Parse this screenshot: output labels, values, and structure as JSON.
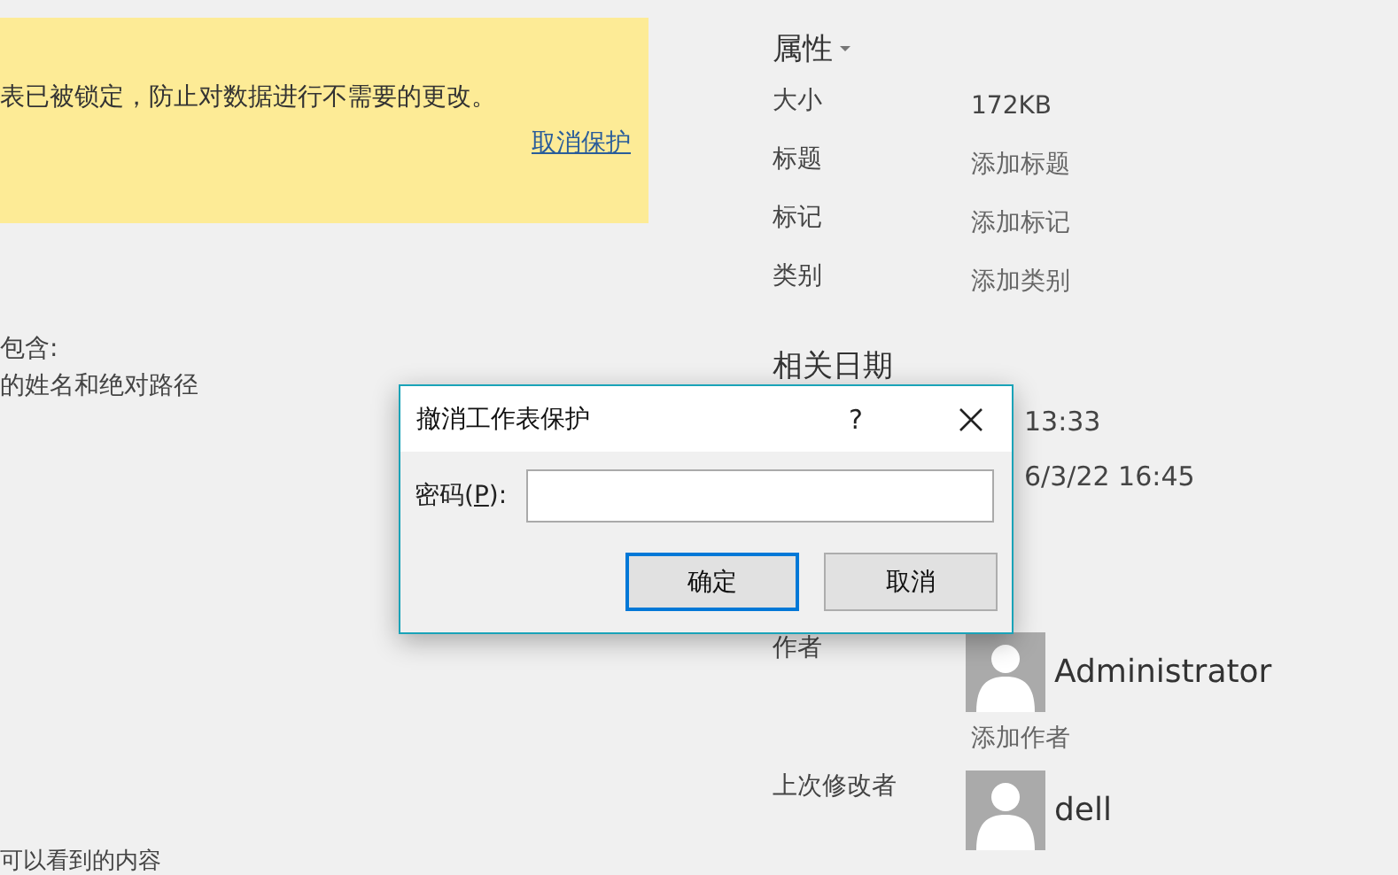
{
  "protection_notice": {
    "message": "表已被锁定，防止对数据进行不需要的更改。",
    "link": "取消保护"
  },
  "inspect_section": {
    "lines": [
      "包含:",
      "的姓名和绝对路径"
    ]
  },
  "bottom_text": "可以看到的内容",
  "properties": {
    "title": "属性",
    "rows": [
      {
        "label": "大小",
        "value": "172KB",
        "kind": "text"
      },
      {
        "label": "标题",
        "value": "添加标题",
        "kind": "link"
      },
      {
        "label": "标记",
        "value": "添加标记",
        "kind": "link"
      },
      {
        "label": "类别",
        "value": "添加类别",
        "kind": "link"
      }
    ]
  },
  "related_dates": {
    "title": "相关日期",
    "values": [
      "13:33",
      "6/3/22 16:45"
    ]
  },
  "people": [
    {
      "label": "作者",
      "name": "Administrator",
      "add_link": "添加作者"
    },
    {
      "label": "上次修改者",
      "name": "dell"
    }
  ],
  "dialog": {
    "title": "撤消工作表保护",
    "help": "?",
    "field": {
      "label_before": "密码(",
      "access_key": "P",
      "label_after": "):"
    },
    "buttons": [
      {
        "label": "确定",
        "default": true
      },
      {
        "label": "取消",
        "default": false
      }
    ]
  }
}
